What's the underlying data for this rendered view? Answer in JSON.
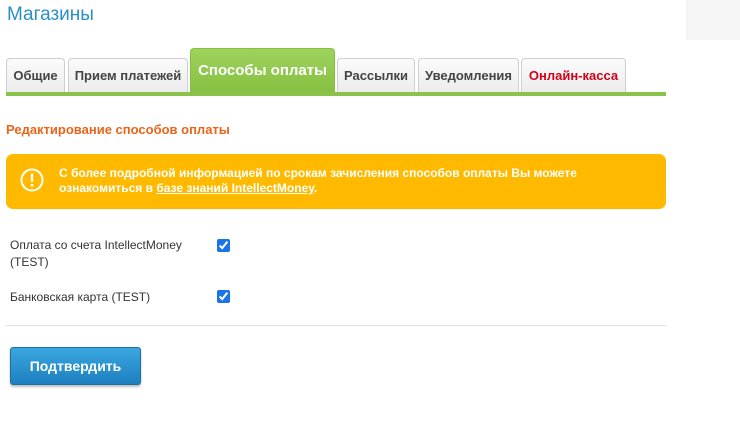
{
  "page": {
    "title": "Магазины"
  },
  "tabs": [
    {
      "label": "Общие",
      "active": false
    },
    {
      "label": "Прием платежей",
      "active": false
    },
    {
      "label": "Способы оплаты",
      "active": true
    },
    {
      "label": "Рассылки",
      "active": false
    },
    {
      "label": "Уведомления",
      "active": false
    },
    {
      "label": "Онлайн-касса",
      "active": false,
      "color": "#d0021b"
    }
  ],
  "section": {
    "title": "Редактирование способов оплаты"
  },
  "alert": {
    "icon": "exclamation-circle-icon",
    "text_before": "С более подробной информацией по срокам зачисления способов оплаты Вы можете ознакомиться в ",
    "link_text": "базе знаний IntellectMoney",
    "text_after": ".",
    "color": "#ffba00"
  },
  "payment_methods": [
    {
      "label": "Оплата со счета IntellectMoney (TEST)",
      "checked": true
    },
    {
      "label": "Банковская карта (TEST)",
      "checked": true
    }
  ],
  "actions": {
    "confirm_label": "Подтвердить"
  },
  "colors": {
    "accent": "#8bc34a",
    "title": "#2a8fc5",
    "section_title": "#e8651a",
    "button": "#1e7fc0"
  }
}
